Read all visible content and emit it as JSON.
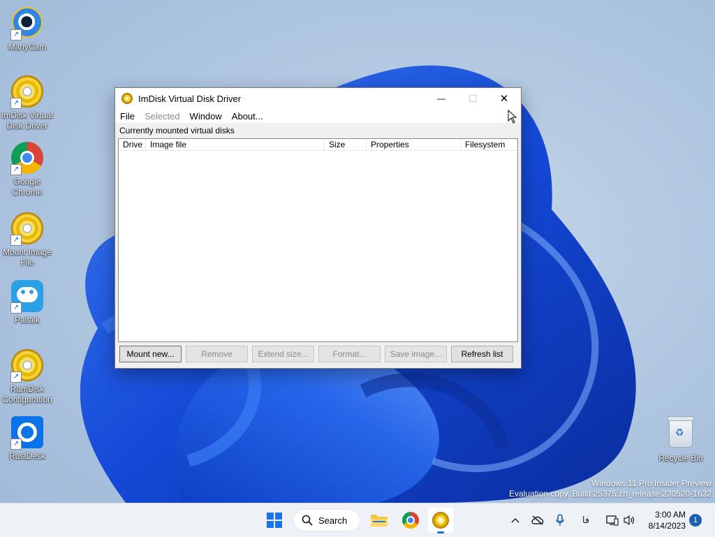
{
  "desktop": {
    "icons": [
      {
        "label_line1": "ManyCam",
        "label_line2": ""
      },
      {
        "label_line1": "ImDisk Virtual",
        "label_line2": "Disk Driver"
      },
      {
        "label_line1": "Google",
        "label_line2": "Chrome"
      },
      {
        "label_line1": "Mount Image",
        "label_line2": "File"
      },
      {
        "label_line1": "Paltalk",
        "label_line2": ""
      },
      {
        "label_line1": "RamDisk",
        "label_line2": "Configuration"
      },
      {
        "label_line1": "RustDesk",
        "label_line2": ""
      },
      {
        "label_line1": "Recycle Bin",
        "label_line2": ""
      }
    ]
  },
  "window": {
    "title": "ImDisk Virtual Disk Driver",
    "controls": {
      "minimize": "—",
      "maximize": "☐",
      "close": "✕"
    },
    "menu": [
      {
        "label": "File",
        "enabled": true
      },
      {
        "label": "Selected",
        "enabled": false
      },
      {
        "label": "Window",
        "enabled": true
      },
      {
        "label": "About...",
        "enabled": true
      }
    ],
    "section_label": "Currently mounted virtual disks",
    "columns": [
      "Drive",
      "Image file",
      "Size",
      "Properties",
      "Filesystem"
    ],
    "rows": [],
    "buttons": [
      {
        "label": "Mount new...",
        "enabled": true
      },
      {
        "label": "Remove",
        "enabled": false
      },
      {
        "label": "Extend size...",
        "enabled": false
      },
      {
        "label": "Format...",
        "enabled": false
      },
      {
        "label": "Save image...",
        "enabled": false
      },
      {
        "label": "Refresh list",
        "enabled": true
      }
    ]
  },
  "watermark": {
    "line1": "Windows 11 Pro Insider Preview",
    "line2": "Evaluation copy. Build 25375.zn_release.230520-1632"
  },
  "taskbar": {
    "search_label": "Search",
    "ime_label": "فا",
    "time": "3:00 AM",
    "date": "8/14/2023",
    "notification_count": "1",
    "active_app": "ImDisk Virtual Disk Driver"
  },
  "colors": {
    "accent": "#1a73c8",
    "wallpaper_blue": "#1f5fe0",
    "disabled_text": "#8a8a8a"
  }
}
